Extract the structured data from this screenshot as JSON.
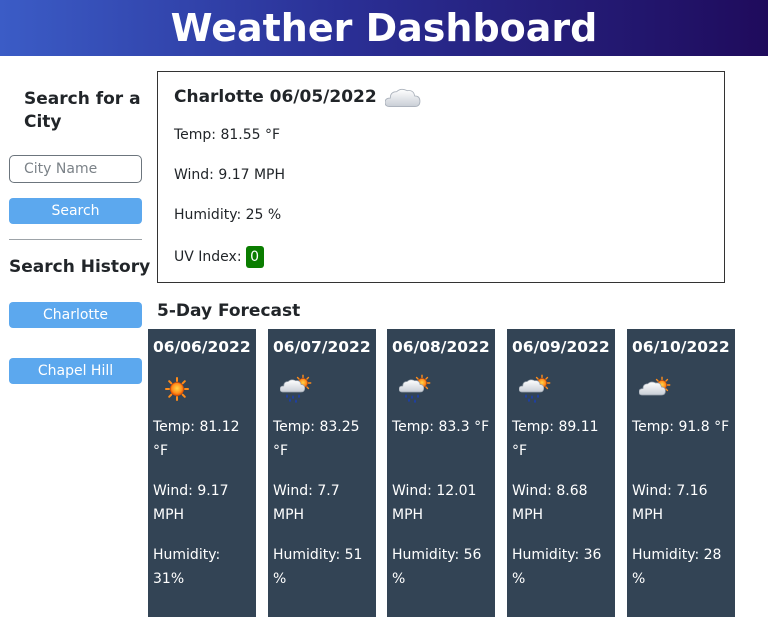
{
  "header": {
    "title": "Weather Dashboard"
  },
  "sidebar": {
    "search_heading": "Search for a City",
    "input_placeholder": "City Name",
    "search_button": "Search",
    "history_heading": "Search History",
    "history": [
      "Charlotte",
      "Chapel Hill"
    ]
  },
  "current": {
    "title": "Charlotte 06/05/2022",
    "icon": "cloud-icon",
    "temp": "Temp: 81.55 °F",
    "wind": "Wind: 9.17 MPH",
    "humidity": "Humidity: 25 %",
    "uv_label": "UV Index:",
    "uv_value": "0",
    "uv_color": "#0a7d00"
  },
  "forecast": {
    "heading": "5-Day Forecast",
    "card_color": "#334455",
    "days": [
      {
        "date": "06/06/2022",
        "icon": "sun-icon",
        "temp": "Temp: 81.12 °F",
        "wind": "Wind: 9.17 MPH",
        "humidity": "Humidity: 31%"
      },
      {
        "date": "06/07/2022",
        "icon": "rain-sun-icon",
        "temp": "Temp: 83.25 °F",
        "wind": "Wind: 7.7 MPH",
        "humidity": "Humidity: 51 %"
      },
      {
        "date": "06/08/2022",
        "icon": "rain-sun-icon",
        "temp": "Temp: 83.3 °F",
        "wind": "Wind: 12.01 MPH",
        "humidity": "Humidity: 56 %"
      },
      {
        "date": "06/09/2022",
        "icon": "rain-sun-icon",
        "temp": "Temp: 89.11 °F",
        "wind": "Wind: 8.68 MPH",
        "humidity": "Humidity: 36 %"
      },
      {
        "date": "06/10/2022",
        "icon": "cloud-sun-icon",
        "temp": "Temp: 91.8 °F",
        "wind": "Wind: 7.16 MPH",
        "humidity": "Humidity: 28 %"
      }
    ]
  },
  "colors": {
    "button": "#5ca8ee",
    "header_start": "#3b5cc6",
    "header_end": "#1f0b5c"
  }
}
